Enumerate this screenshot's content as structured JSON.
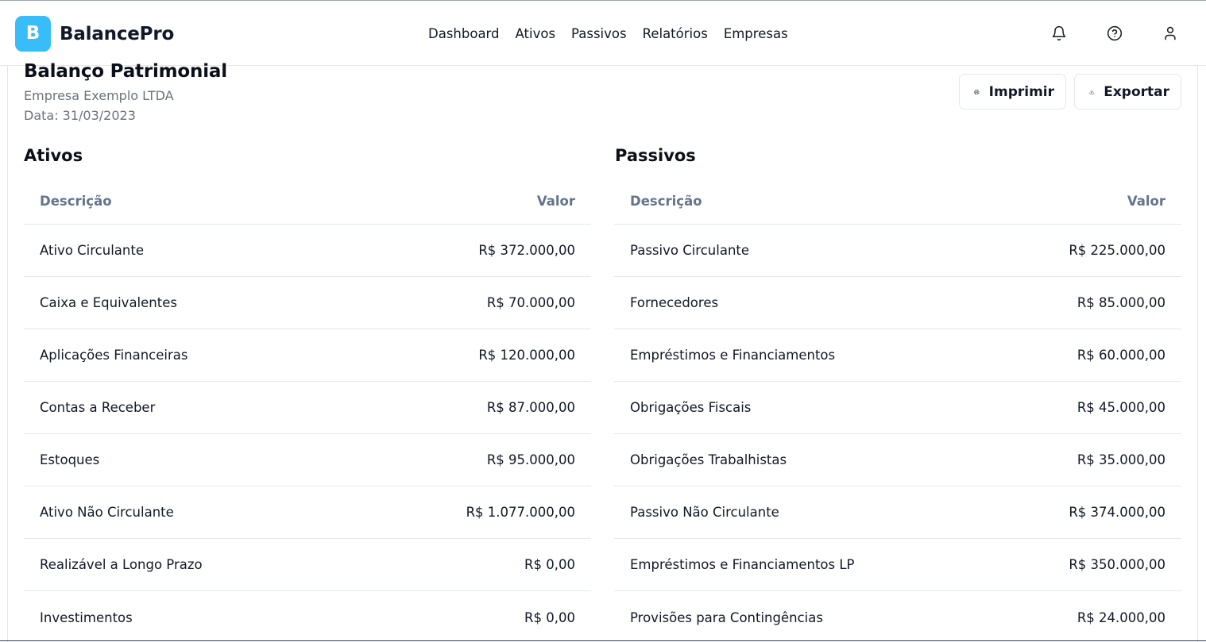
{
  "app": {
    "logo_letter": "B",
    "brand": "BalancePro",
    "nav": [
      "Dashboard",
      "Ativos",
      "Passivos",
      "Relatórios",
      "Empresas"
    ]
  },
  "header_icons": [
    "bell-icon",
    "help-circle-icon",
    "user-icon"
  ],
  "page": {
    "title": "Balanço Patrimonial",
    "company": "Empresa Exemplo LTDA",
    "date": "Data: 31/03/2023",
    "print_label": "Imprimir",
    "export_label": "Exportar"
  },
  "ativos": {
    "title": "Ativos",
    "col_desc": "Descrição",
    "col_value": "Valor",
    "rows": [
      {
        "label": "Ativo Circulante",
        "value": "R$ 372.000,00"
      },
      {
        "label": "Caixa e Equivalentes",
        "value": "R$ 70.000,00"
      },
      {
        "label": "Aplicações Financeiras",
        "value": "R$ 120.000,00"
      },
      {
        "label": "Contas a Receber",
        "value": "R$ 87.000,00"
      },
      {
        "label": "Estoques",
        "value": "R$ 95.000,00"
      },
      {
        "label": "Ativo Não Circulante",
        "value": "R$ 1.077.000,00"
      },
      {
        "label": "Realizável a Longo Prazo",
        "value": "R$ 0,00"
      },
      {
        "label": "Investimentos",
        "value": "R$ 0,00"
      }
    ]
  },
  "passivos": {
    "title": "Passivos",
    "col_desc": "Descrição",
    "col_value": "Valor",
    "rows": [
      {
        "label": "Passivo Circulante",
        "value": "R$ 225.000,00"
      },
      {
        "label": "Fornecedores",
        "value": "R$ 85.000,00"
      },
      {
        "label": "Empréstimos e Financiamentos",
        "value": "R$ 60.000,00"
      },
      {
        "label": "Obrigações Fiscais",
        "value": "R$ 45.000,00"
      },
      {
        "label": "Obrigações Trabalhistas",
        "value": "R$ 35.000,00"
      },
      {
        "label": "Passivo Não Circulante",
        "value": "R$ 374.000,00"
      },
      {
        "label": "Empréstimos e Financiamentos LP",
        "value": "R$ 350.000,00"
      },
      {
        "label": "Provisões para Contingências",
        "value": "R$ 24.000,00"
      }
    ]
  },
  "colors": {
    "accent": "#38bdf8",
    "muted_text": "#6b7280",
    "header_text": "#64748b",
    "border": "#e5e7eb"
  }
}
